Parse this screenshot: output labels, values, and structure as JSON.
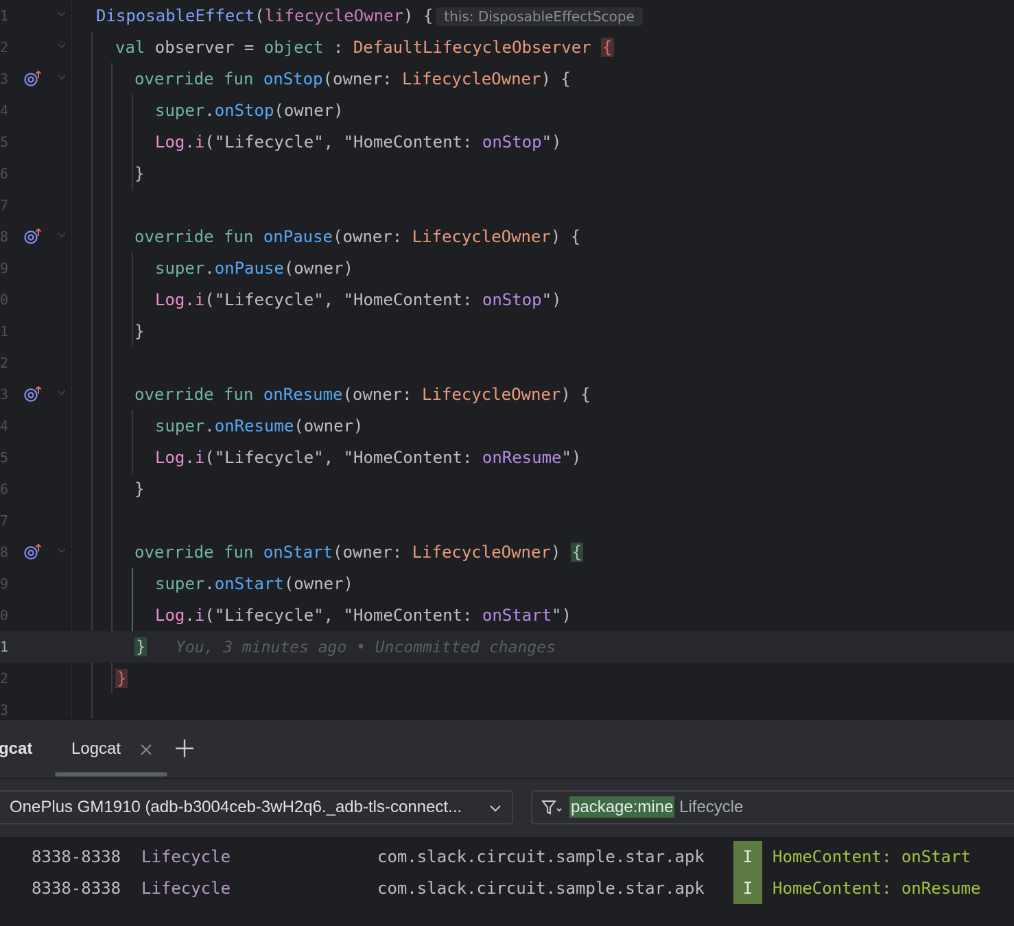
{
  "editor": {
    "lines": [
      {
        "ln": "1",
        "indent": 140,
        "icon": false,
        "fold": true,
        "current": false
      },
      {
        "ln": "2",
        "indent": 168,
        "icon": false,
        "fold": true,
        "current": false
      },
      {
        "ln": "3",
        "indent": 196,
        "icon": true,
        "fold": true,
        "current": false
      },
      {
        "ln": "4",
        "indent": 226,
        "icon": false,
        "fold": false,
        "current": false
      },
      {
        "ln": "5",
        "indent": 226,
        "icon": false,
        "fold": false,
        "current": false
      },
      {
        "ln": "6",
        "indent": 196,
        "icon": false,
        "fold": false,
        "current": false
      },
      {
        "ln": "7",
        "indent": 196,
        "icon": false,
        "fold": false,
        "current": false
      },
      {
        "ln": "8",
        "indent": 196,
        "icon": true,
        "fold": true,
        "current": false
      },
      {
        "ln": "9",
        "indent": 226,
        "icon": false,
        "fold": false,
        "current": false
      },
      {
        "ln": "0",
        "indent": 226,
        "icon": false,
        "fold": false,
        "current": false
      },
      {
        "ln": "1",
        "indent": 196,
        "icon": false,
        "fold": false,
        "current": false
      },
      {
        "ln": "2",
        "indent": 196,
        "icon": false,
        "fold": false,
        "current": false
      },
      {
        "ln": "3",
        "indent": 196,
        "icon": true,
        "fold": true,
        "current": false
      },
      {
        "ln": "4",
        "indent": 226,
        "icon": false,
        "fold": false,
        "current": false
      },
      {
        "ln": "5",
        "indent": 226,
        "icon": false,
        "fold": false,
        "current": false
      },
      {
        "ln": "6",
        "indent": 196,
        "icon": false,
        "fold": false,
        "current": false
      },
      {
        "ln": "7",
        "indent": 196,
        "icon": false,
        "fold": false,
        "current": false
      },
      {
        "ln": "8",
        "indent": 196,
        "icon": true,
        "fold": true,
        "current": false
      },
      {
        "ln": "9",
        "indent": 226,
        "icon": false,
        "fold": false,
        "current": false
      },
      {
        "ln": "0",
        "indent": 226,
        "icon": false,
        "fold": false,
        "current": false
      },
      {
        "ln": "1",
        "indent": 196,
        "icon": false,
        "fold": false,
        "current": true
      },
      {
        "ln": "2",
        "indent": 168,
        "icon": false,
        "fold": false,
        "current": false
      },
      {
        "ln": "3",
        "indent": 140,
        "icon": false,
        "fold": false,
        "current": false
      }
    ],
    "tokens": {
      "l1": [
        {
          "c": "fnc",
          "t": "DisposableEffect"
        },
        {
          "c": "plain",
          "t": "("
        },
        {
          "c": "param",
          "t": "lifecycleOwner"
        },
        {
          "c": "plain",
          "t": ") {"
        }
      ],
      "l1_hint": "this: DisposableEffectScope",
      "l2": [
        {
          "c": "kw",
          "t": "val "
        },
        {
          "c": "plain",
          "t": "observer = "
        },
        {
          "c": "kw",
          "t": "object"
        },
        {
          "c": "plain",
          "t": " : "
        },
        {
          "c": "ty",
          "t": "DefaultLifecycleObserver "
        }
      ],
      "l2_brace": "{",
      "l3": [
        {
          "c": "kw",
          "t": "override fun "
        },
        {
          "c": "fn",
          "t": "onStop"
        },
        {
          "c": "plain",
          "t": "(owner: "
        },
        {
          "c": "ty",
          "t": "LifecycleOwner"
        },
        {
          "c": "plain",
          "t": ") {"
        }
      ],
      "l4": [
        {
          "c": "kw",
          "t": "super"
        },
        {
          "c": "plain",
          "t": "."
        },
        {
          "c": "fn",
          "t": "onStop"
        },
        {
          "c": "plain",
          "t": "(owner)"
        }
      ],
      "l5": [
        {
          "c": "tag",
          "t": "Log"
        },
        {
          "c": "plain",
          "t": "."
        },
        {
          "c": "tag",
          "t": "i"
        },
        {
          "c": "plain",
          "t": "("
        },
        {
          "c": "plain",
          "t": "\"Lifecycle\""
        },
        {
          "c": "plain",
          "t": ", "
        },
        {
          "c": "plain",
          "t": "\"HomeContent: "
        },
        {
          "c": "strlit",
          "t": "onStop"
        },
        {
          "c": "plain",
          "t": "\")"
        }
      ],
      "l6": [
        {
          "c": "plain",
          "t": "}"
        }
      ],
      "l8": [
        {
          "c": "kw",
          "t": "override fun "
        },
        {
          "c": "fn",
          "t": "onPause"
        },
        {
          "c": "plain",
          "t": "(owner: "
        },
        {
          "c": "ty",
          "t": "LifecycleOwner"
        },
        {
          "c": "plain",
          "t": ") {"
        }
      ],
      "l9": [
        {
          "c": "kw",
          "t": "super"
        },
        {
          "c": "plain",
          "t": "."
        },
        {
          "c": "fn",
          "t": "onPause"
        },
        {
          "c": "plain",
          "t": "(owner)"
        }
      ],
      "l10": [
        {
          "c": "tag",
          "t": "Log"
        },
        {
          "c": "plain",
          "t": "."
        },
        {
          "c": "tag",
          "t": "i"
        },
        {
          "c": "plain",
          "t": "("
        },
        {
          "c": "plain",
          "t": "\"Lifecycle\""
        },
        {
          "c": "plain",
          "t": ", "
        },
        {
          "c": "plain",
          "t": "\"HomeContent: "
        },
        {
          "c": "strlit",
          "t": "onStop"
        },
        {
          "c": "plain",
          "t": "\")"
        }
      ],
      "l11": [
        {
          "c": "plain",
          "t": "}"
        }
      ],
      "l13": [
        {
          "c": "kw",
          "t": "override fun "
        },
        {
          "c": "fn",
          "t": "onResume"
        },
        {
          "c": "plain",
          "t": "(owner: "
        },
        {
          "c": "ty",
          "t": "LifecycleOwner"
        },
        {
          "c": "plain",
          "t": ") {"
        }
      ],
      "l14": [
        {
          "c": "kw",
          "t": "super"
        },
        {
          "c": "plain",
          "t": "."
        },
        {
          "c": "fn",
          "t": "onResume"
        },
        {
          "c": "plain",
          "t": "(owner)"
        }
      ],
      "l15": [
        {
          "c": "tag",
          "t": "Log"
        },
        {
          "c": "plain",
          "t": "."
        },
        {
          "c": "tag",
          "t": "i"
        },
        {
          "c": "plain",
          "t": "("
        },
        {
          "c": "plain",
          "t": "\"Lifecycle\""
        },
        {
          "c": "plain",
          "t": ", "
        },
        {
          "c": "plain",
          "t": "\"HomeContent: "
        },
        {
          "c": "strlit",
          "t": "onResume"
        },
        {
          "c": "plain",
          "t": "\")"
        }
      ],
      "l16": [
        {
          "c": "plain",
          "t": "}"
        }
      ],
      "l18": [
        {
          "c": "kw",
          "t": "override fun "
        },
        {
          "c": "fn",
          "t": "onStart"
        },
        {
          "c": "plain",
          "t": "(owner: "
        },
        {
          "c": "ty",
          "t": "LifecycleOwner"
        },
        {
          "c": "plain",
          "t": ") "
        }
      ],
      "l18_brace": "{",
      "l19": [
        {
          "c": "kw",
          "t": "super"
        },
        {
          "c": "plain",
          "t": "."
        },
        {
          "c": "fn",
          "t": "onStart"
        },
        {
          "c": "plain",
          "t": "(owner)"
        }
      ],
      "l20": [
        {
          "c": "tag",
          "t": "Log"
        },
        {
          "c": "plain",
          "t": "."
        },
        {
          "c": "tag",
          "t": "i"
        },
        {
          "c": "plain",
          "t": "("
        },
        {
          "c": "plain",
          "t": "\"Lifecycle\""
        },
        {
          "c": "plain",
          "t": ", "
        },
        {
          "c": "plain",
          "t": "\"HomeContent: "
        },
        {
          "c": "strlit",
          "t": "onStart"
        },
        {
          "c": "plain",
          "t": "\")"
        }
      ],
      "l21_brace": "}",
      "l21_blame": "You, 3 minutes ago • Uncommitted changes",
      "l22_brace": "}"
    }
  },
  "logcat": {
    "tabs": [
      {
        "label": "gcat"
      },
      {
        "label": "Logcat"
      }
    ],
    "device": "OnePlus GM1910 (adb-b3004ceb-3wH2q6._adb-tls-connect...",
    "filter_token": "package:mine",
    "filter_rest": " Lifecycle",
    "rows": [
      {
        "pid": "8338-8338",
        "tag": "Lifecycle",
        "pkg": "com.slack.circuit.sample.star.apk",
        "level": "I",
        "message": "HomeContent: onStart"
      },
      {
        "pid": "8338-8338",
        "tag": "Lifecycle",
        "pkg": "com.slack.circuit.sample.star.apk",
        "level": "I",
        "message": "HomeContent: onResume"
      }
    ]
  },
  "colors": {
    "background": "#1e1f22",
    "panel": "#2b2d30",
    "info_badge": "#5d7a43",
    "message_green": "#a8c23f",
    "filter_token_bg": "#3f6a48"
  }
}
